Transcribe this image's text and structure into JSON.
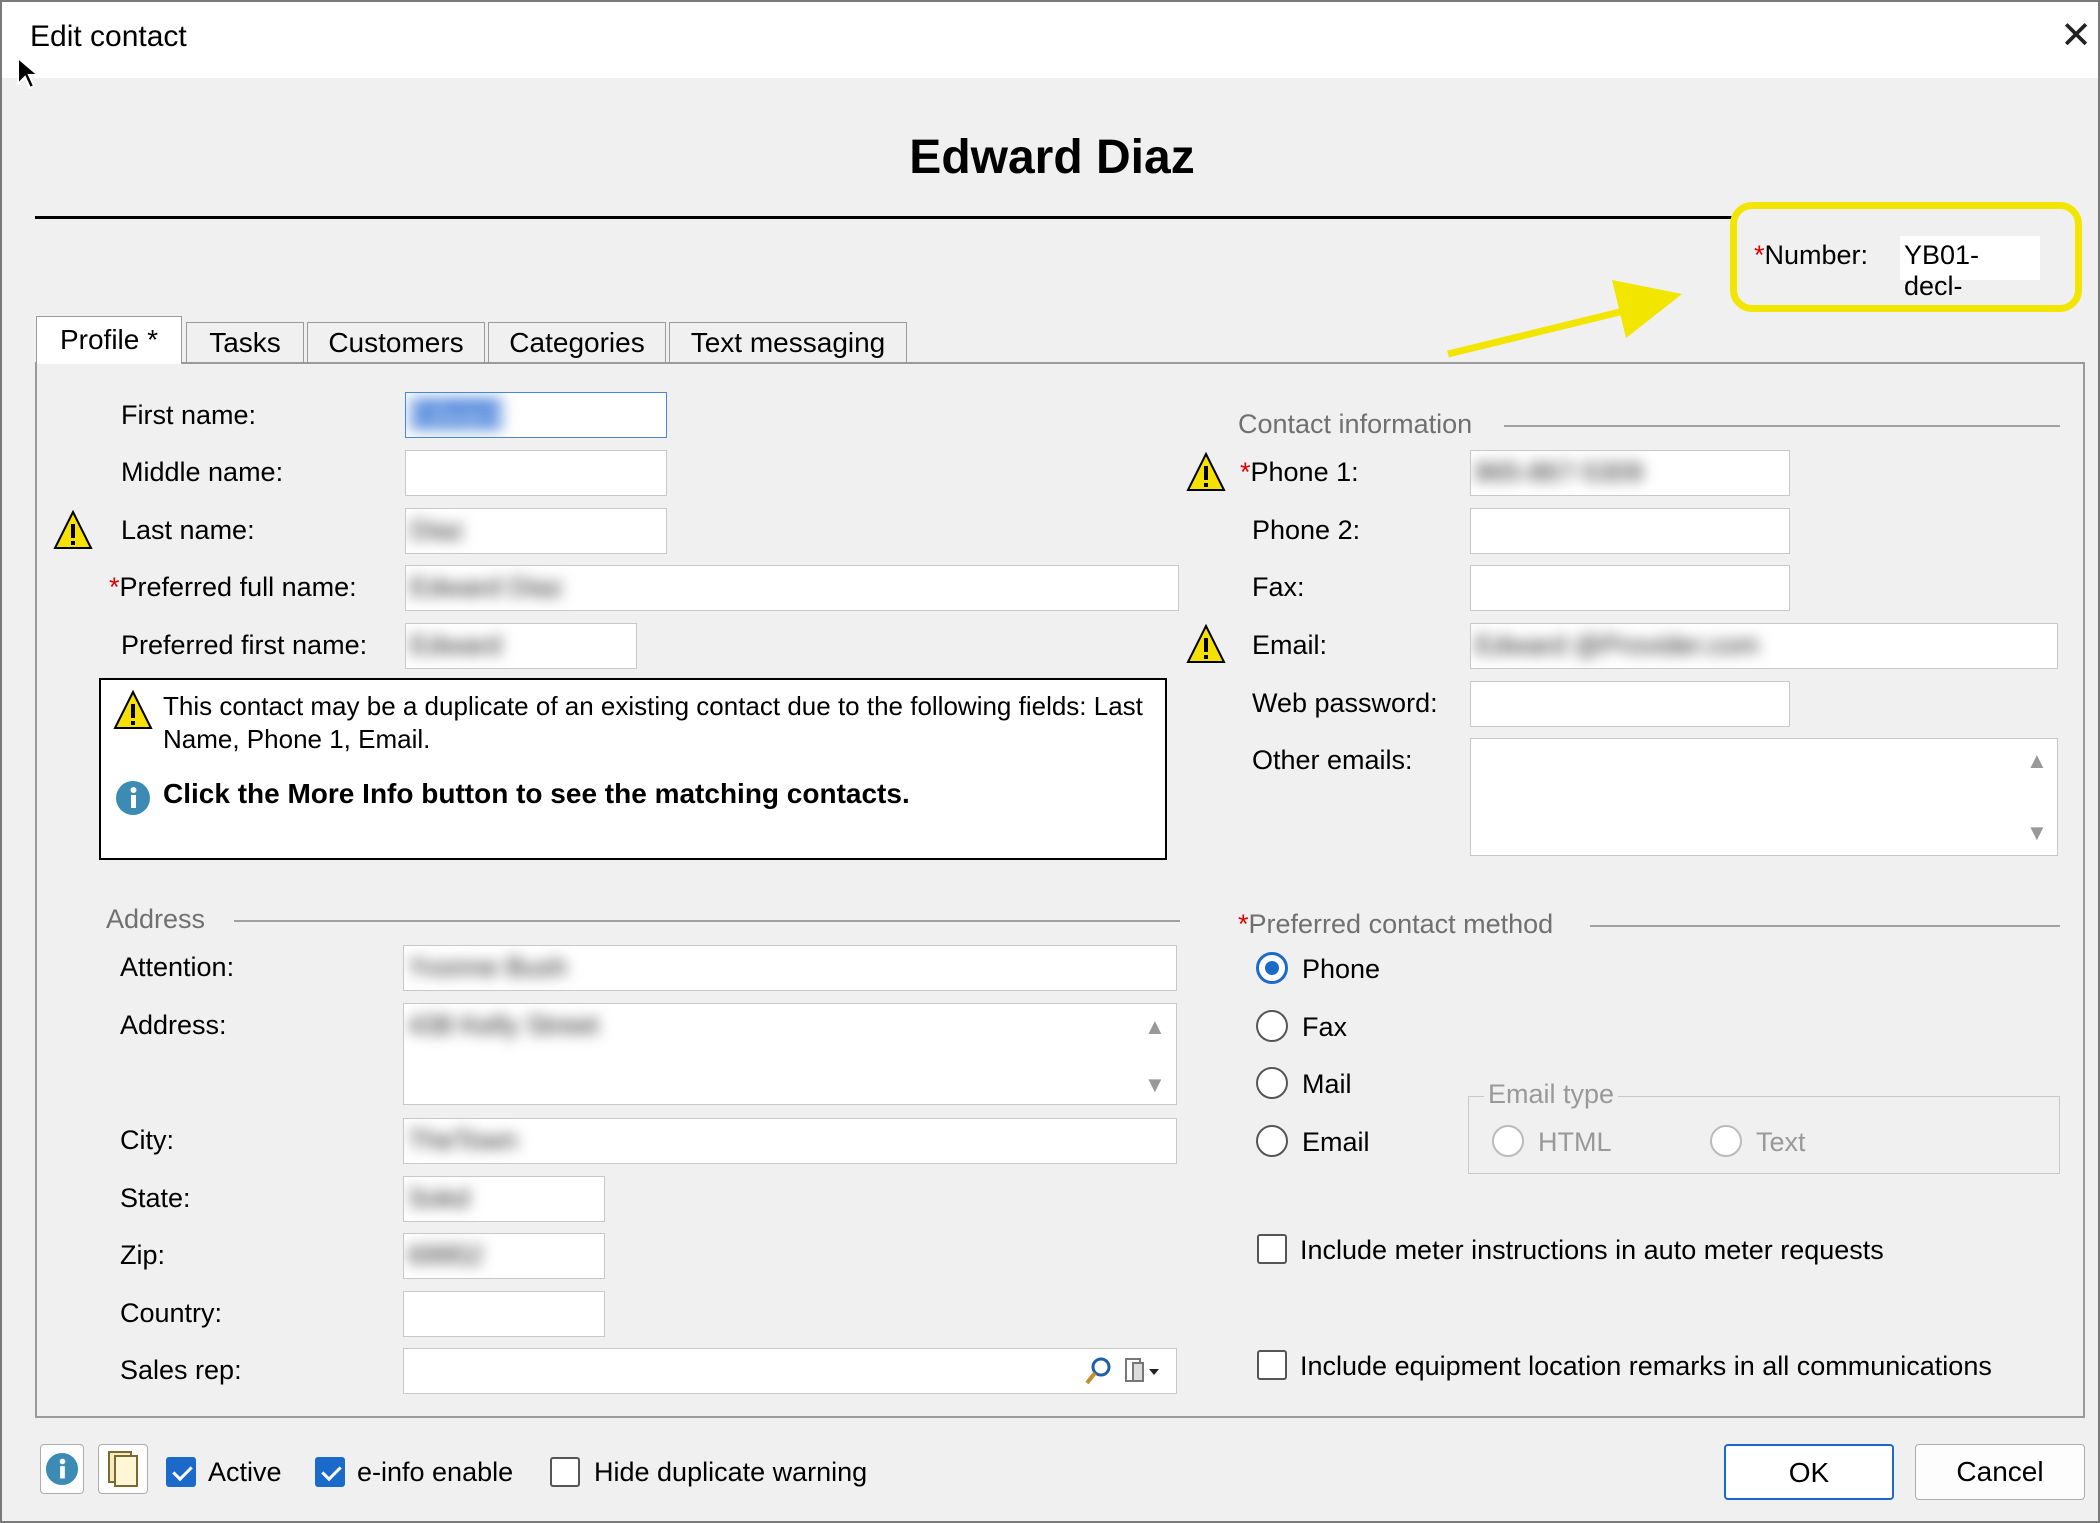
{
  "window": {
    "title": "Edit contact",
    "close_label": "✕"
  },
  "heading": "Edward Diaz",
  "number": {
    "label": "Number:",
    "value": "YB01-decl-"
  },
  "tabs": [
    "Profile *",
    "Tasks",
    "Customers",
    "Categories",
    "Text messaging"
  ],
  "profile": {
    "first_name": {
      "label": "First name:",
      "value": "Edward"
    },
    "middle_name": {
      "label": "Middle name:",
      "value": ""
    },
    "last_name": {
      "label": "Last name:",
      "value": "Diaz"
    },
    "preferred_full_name": {
      "label": "Preferred full name:",
      "value": "Edward Diaz"
    },
    "preferred_first_name": {
      "label": "Preferred first name:",
      "value": "Edward"
    }
  },
  "duplicate_warning": {
    "message": "This contact may be a duplicate of an existing contact due to the following fields: Last Name, Phone 1, Email.",
    "info": "Click the More Info button to see the matching contacts."
  },
  "address": {
    "section_label": "Address",
    "attention": {
      "label": "Attention:",
      "value": "Yvonne Bush"
    },
    "address": {
      "label": "Address:",
      "value": "438 Kelly Street"
    },
    "city": {
      "label": "City:",
      "value": "TheTown"
    },
    "state": {
      "label": "State:",
      "value": "Sokd"
    },
    "zip": {
      "label": "Zip:",
      "value": "69952"
    },
    "country": {
      "label": "Country:",
      "value": ""
    },
    "sales_rep": {
      "label": "Sales rep:",
      "value": ""
    }
  },
  "contact_info": {
    "section_label": "Contact information",
    "phone1": {
      "label": "Phone 1:",
      "value": "865-867-5309"
    },
    "phone2": {
      "label": "Phone 2:",
      "value": ""
    },
    "fax": {
      "label": "Fax:",
      "value": ""
    },
    "email": {
      "label": "Email:",
      "value": "Edward @Provider.com"
    },
    "web_password": {
      "label": "Web password:",
      "value": ""
    },
    "other_emails": {
      "label": "Other emails:",
      "value": ""
    }
  },
  "preferred_method": {
    "section_label": "Preferred contact method",
    "options": [
      "Phone",
      "Fax",
      "Mail",
      "Email"
    ],
    "selected": "Phone",
    "email_type": {
      "label": "Email type",
      "options": [
        "HTML",
        "Text"
      ]
    }
  },
  "options": {
    "meter_instructions": "Include meter instructions in auto meter requests",
    "equipment_remarks": "Include equipment location remarks in all communications"
  },
  "footer": {
    "active": "Active",
    "einfo": "e-info enable",
    "hide_dup": "Hide duplicate warning",
    "ok": "OK",
    "cancel": "Cancel"
  },
  "colors": {
    "accent": "#1b6ac9",
    "highlight": "#f2e500",
    "required": "#e00000"
  }
}
